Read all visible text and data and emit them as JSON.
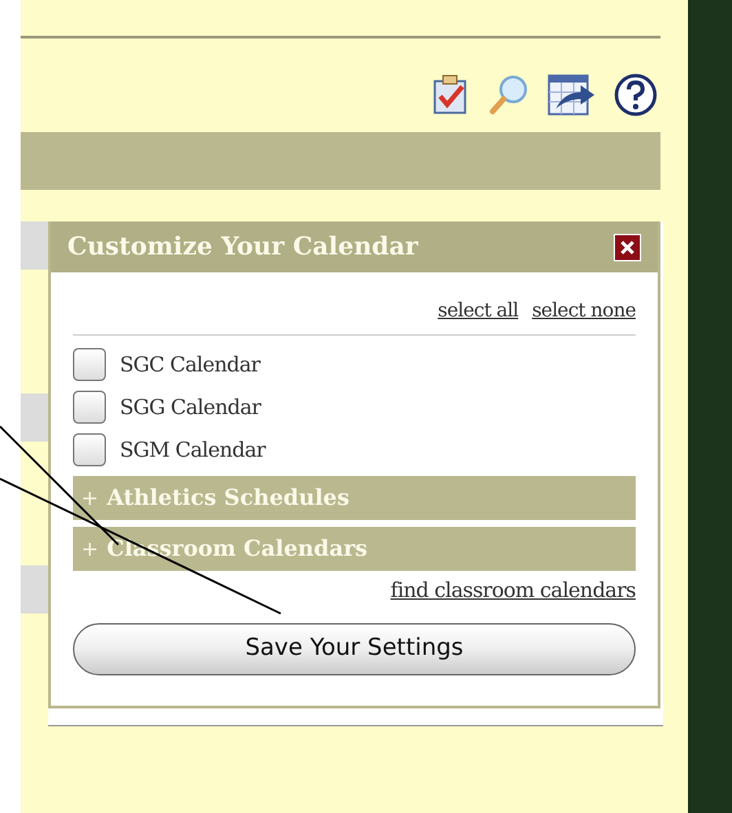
{
  "panel": {
    "title": "Customize Your Calendar",
    "links": [
      "select all",
      "select none"
    ],
    "calendars": [
      {
        "label": "SGC Calendar",
        "checked": false
      },
      {
        "label": "SGG Calendar",
        "checked": false
      },
      {
        "label": "SGM Calendar",
        "checked": false
      }
    ],
    "sections": [
      {
        "marker": "+",
        "label": "Athletics Schedules",
        "expanded": false
      },
      {
        "marker": "+",
        "label": "Classroom Calendars",
        "expanded": false
      }
    ],
    "find_link": "find classroom calendars",
    "save_button": "Save Your Settings"
  }
}
